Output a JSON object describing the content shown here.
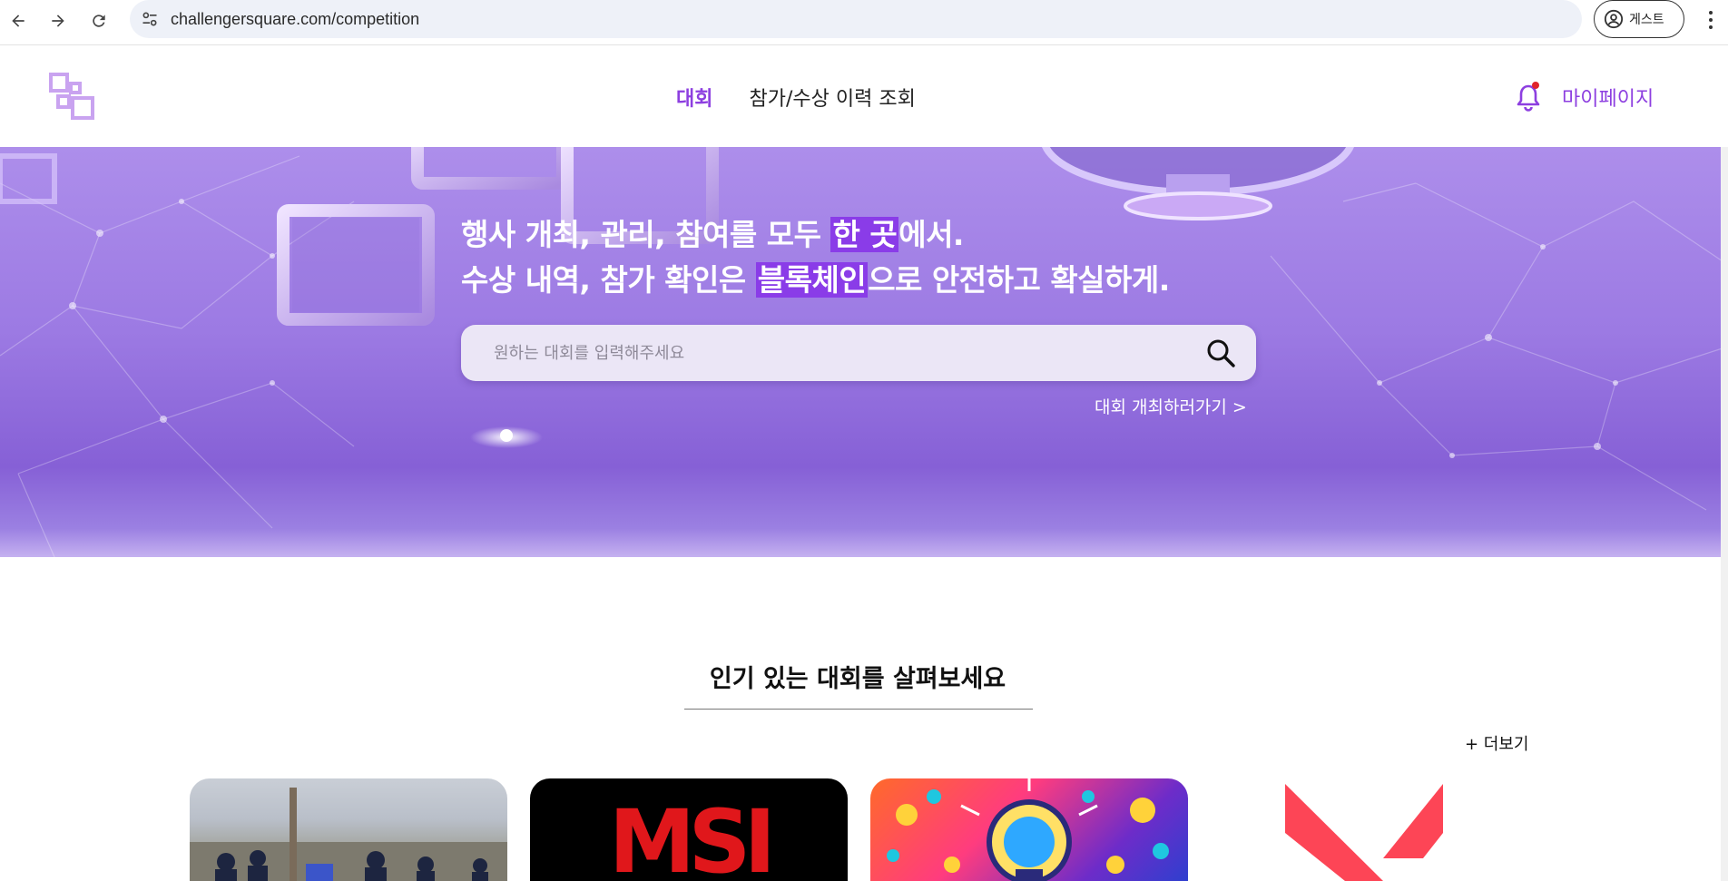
{
  "browser": {
    "url": "challengersquare.com/competition",
    "profile_label": "게스트"
  },
  "header": {
    "nav": [
      {
        "label": "대회",
        "active": true
      },
      {
        "label": "참가/수상 이력 조회",
        "active": false
      }
    ],
    "mypage_label": "마이페이지",
    "accent_color": "#8d3fe0"
  },
  "hero": {
    "line1_a": "행사 개최, 관리, 참여를 모두 ",
    "line1_hl": "한 곳",
    "line1_b": "에서.",
    "line2_a": "수상 내역, 참가 확인은 ",
    "line2_hl": "블록체인",
    "line2_b": "으로 안전하고 확실하게.",
    "search_placeholder": "원하는 대회를 입력해주세요",
    "host_link": "대회 개최하러가기 >"
  },
  "popular": {
    "title": "인기 있는 대회를 살펴보세요",
    "more_label": "+ 더보기",
    "cards": [
      {
        "image": "outdoor-crowd-photo"
      },
      {
        "image": "msi-logo",
        "text": "MSI"
      },
      {
        "image": "lightbulb-illustration"
      },
      {
        "image": "valorant-logo"
      }
    ]
  }
}
